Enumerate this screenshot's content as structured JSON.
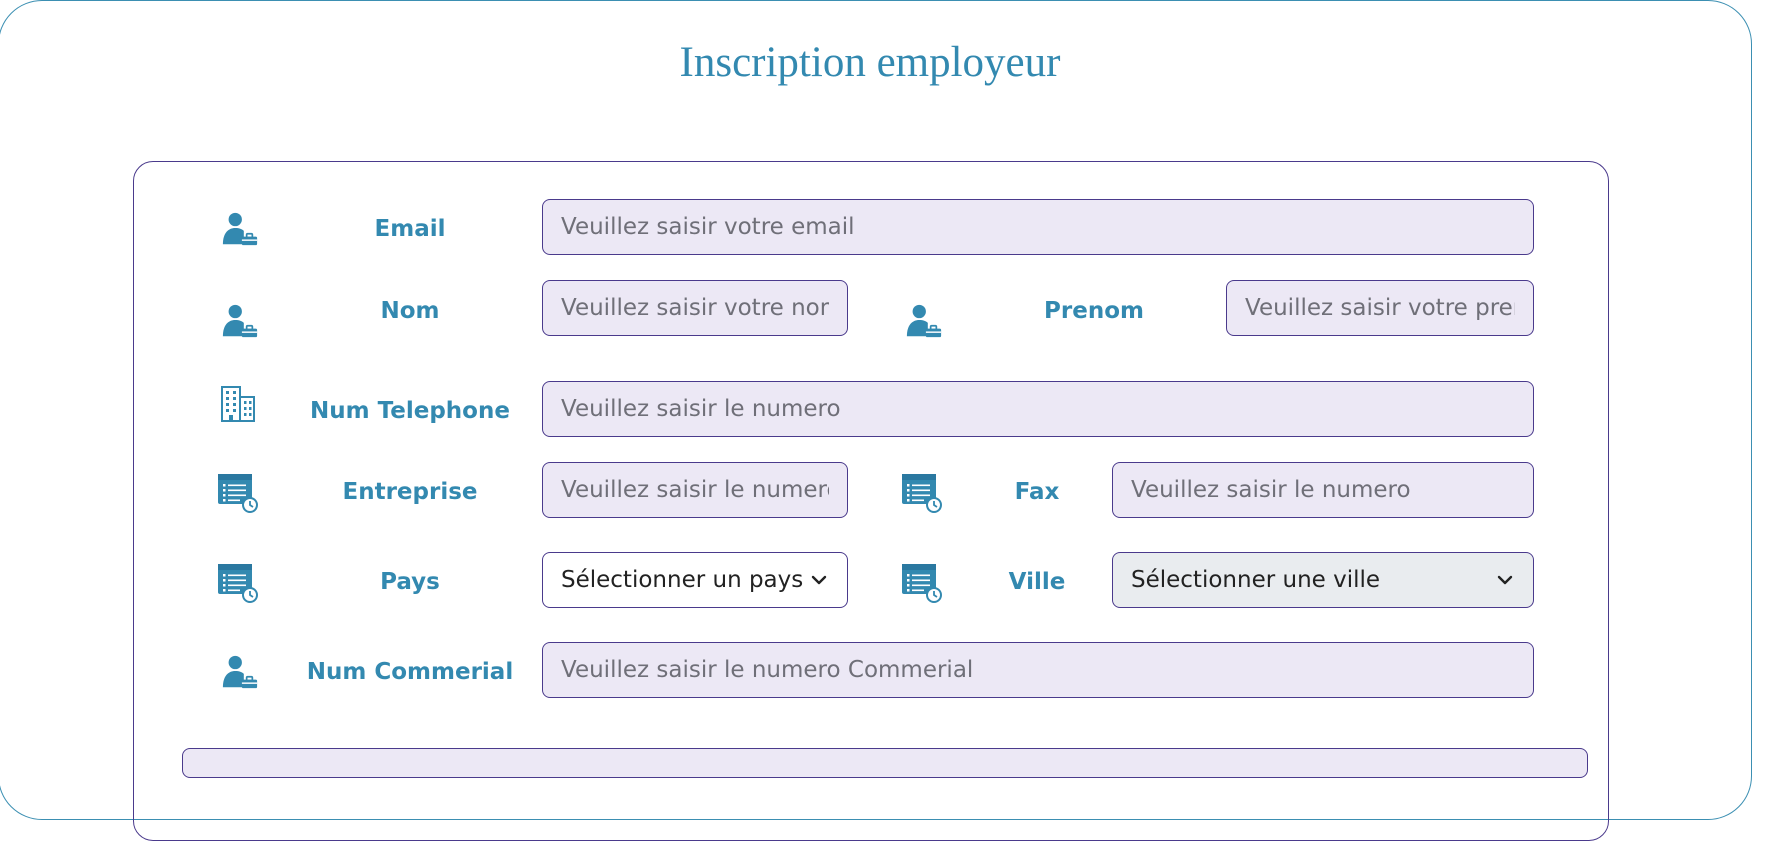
{
  "page": {
    "title": "Inscription employeur"
  },
  "form": {
    "email": {
      "label": "Email",
      "placeholder": "Veuillez saisir votre email",
      "icon": "user-badge-icon"
    },
    "nom": {
      "label": "Nom",
      "placeholder": "Veuillez saisir votre nom",
      "icon": "user-badge-icon"
    },
    "prenom": {
      "label": "Prenom",
      "placeholder": "Veuillez saisir votre prenom",
      "icon": "user-badge-icon"
    },
    "telephone": {
      "label": "Num Telephone",
      "placeholder": "Veuillez saisir le numero",
      "icon": "building-icon"
    },
    "entreprise": {
      "label": "Entreprise",
      "placeholder": "Veuillez saisir le numero",
      "icon": "schedule-list-icon"
    },
    "fax": {
      "label": "Fax",
      "placeholder": "Veuillez saisir le numero",
      "icon": "schedule-list-icon"
    },
    "pays": {
      "label": "Pays",
      "selected": "Sélectionner un pays",
      "icon": "schedule-list-icon"
    },
    "ville": {
      "label": "Ville",
      "selected": "Sélectionner une ville",
      "icon": "schedule-list-icon"
    },
    "commercial": {
      "label": "Num Commerial",
      "placeholder": "Veuillez saisir le numero Commerial",
      "icon": "user-badge-icon"
    }
  },
  "colors": {
    "accent": "#3389b0",
    "border": "#4a3a8c",
    "input_bg": "#ece8f5",
    "select_disabled_bg": "#e9ecef"
  }
}
